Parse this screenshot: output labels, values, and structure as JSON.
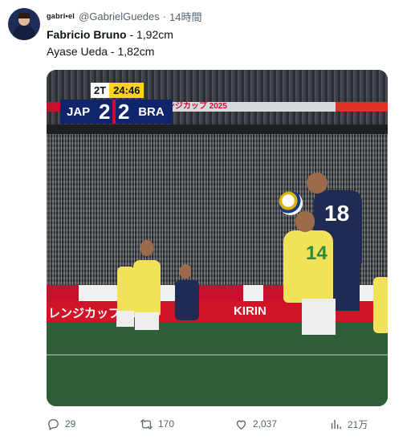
{
  "tweet": {
    "display_name": "gabri•el",
    "handle": "@GabrielGuedes",
    "separator": "·",
    "time": "14時間",
    "line1_name": "Fabricio Bruno",
    "line1_rest": " - 1,92cm",
    "line2": "Ayase Ueda - 1,82cm"
  },
  "media": {
    "period": "2T",
    "clock": "24:46",
    "home_team": "JAP",
    "home_score": "2",
    "away_score": "2",
    "away_team": "BRA",
    "board_text": "キリンチャレンジカップ 2025",
    "ad_left": "レンジカップ 20",
    "ad_right": "KIRIN",
    "jersey_navy": "18",
    "jersey_yellow": "14"
  },
  "actions": {
    "replies": "29",
    "retweets": "170",
    "likes": "2,037",
    "views": "21万"
  },
  "colors": {
    "score_bg": "#10246b",
    "clock_bg": "#ffd21f",
    "ad_red": "#d01528",
    "brazil_yellow": "#f1e25a",
    "japan_navy": "#1f2a55"
  }
}
